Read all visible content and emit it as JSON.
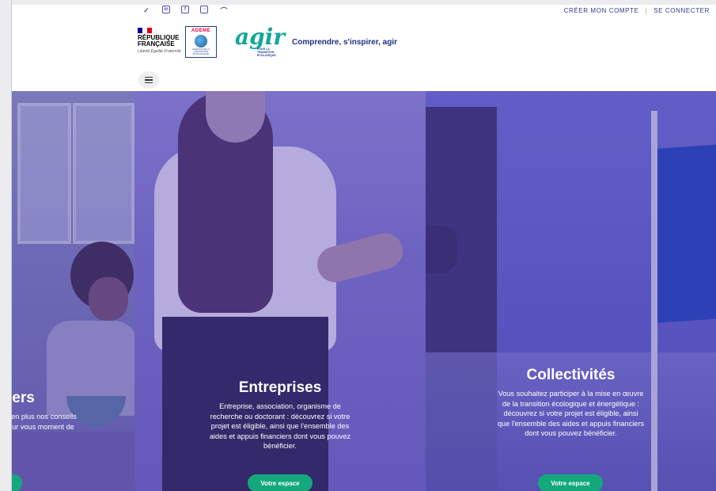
{
  "topbar": {
    "social_icons": [
      "twitter-icon",
      "linkedin-icon",
      "facebook-icon",
      "instagram-icon",
      "rss-icon"
    ],
    "create_account": "CRÉER MON COMPTE",
    "separator": "|",
    "login": "SE CONNECTER"
  },
  "header": {
    "republic_line1": "RÉPUBLIQUE",
    "republic_line2": "FRANÇAISE",
    "motto": "Liberté Égalité Fraternité",
    "ademe_name": "ADEME",
    "ademe_sub": "AGENCE DE LA TRANSITION ÉCOLOGIQUE",
    "agir_word": "agir",
    "agir_tag": "POUR LA TRANSITION ÉCOLOGIQUE",
    "slogan": "Comprendre, s'inspirer, agir"
  },
  "colors": {
    "brand_blue": "#1e2f80",
    "cta_green": "#14a87c",
    "hero_purple": "#6c63bf"
  },
  "panels": [
    {
      "title": "iers",
      "text": "lien plus nos conseils our vous moment de",
      "button": "s"
    },
    {
      "title": "Entreprises",
      "text": "Entreprise, association, organisme de recherche ou doctorant : découvrez si votre projet est éligible, ainsi que l'ensemble des aides et appuis financiers dont vous pouvez bénéficier.",
      "button": "Votre espace"
    },
    {
      "title": "Collectivités",
      "text": "Vous souhaitez participer à la mise en œuvre de la transition écologique et énergétique : découvrez si votre projet est éligible, ainsi que l'ensemble des aides et appuis financiers dont vous pouvez bénéficier.",
      "button": "Votre espace"
    }
  ]
}
